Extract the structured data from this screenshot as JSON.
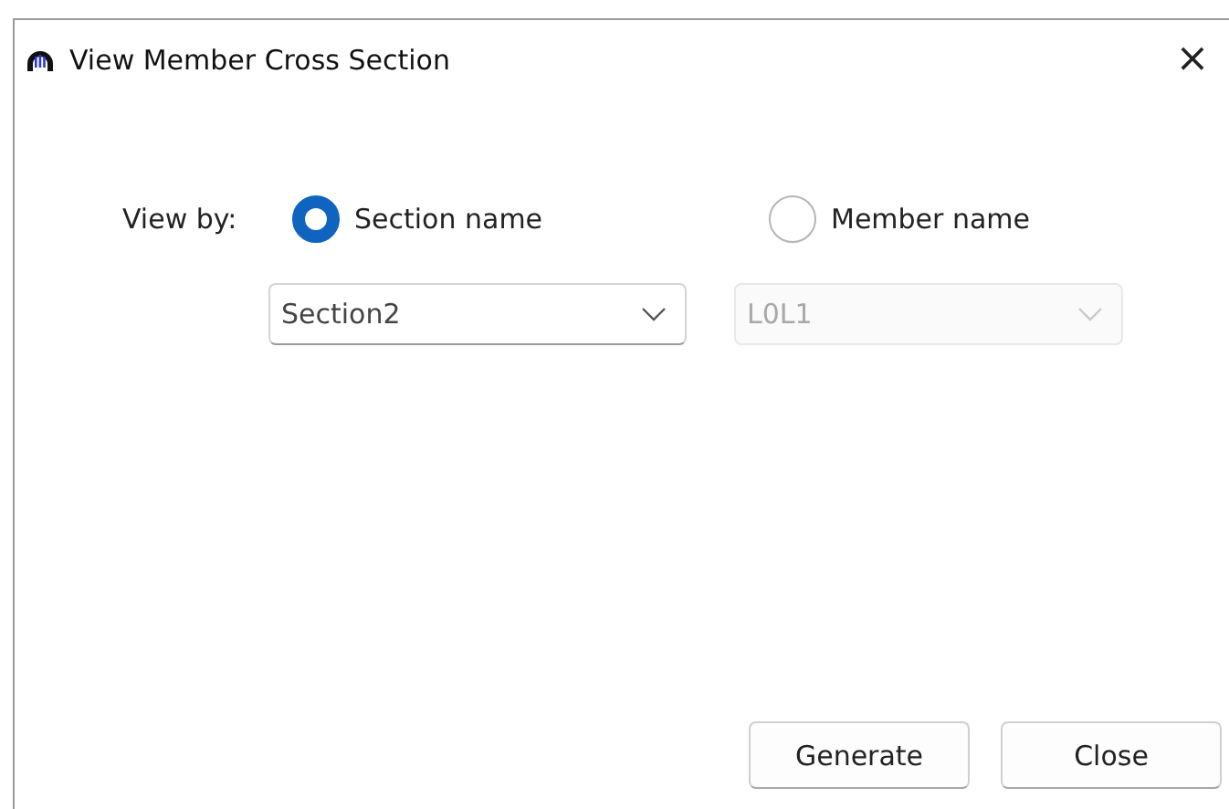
{
  "window": {
    "title": "View Member Cross Section",
    "close": "×"
  },
  "view_by": {
    "label": "View by:",
    "options": [
      {
        "label": "Section name",
        "selected": true,
        "dropdown": {
          "value": "Section2",
          "disabled": false
        }
      },
      {
        "label": "Member name",
        "selected": false,
        "dropdown": {
          "value": "L0L1",
          "disabled": true
        }
      }
    ]
  },
  "buttons": [
    "Generate",
    "Close"
  ]
}
